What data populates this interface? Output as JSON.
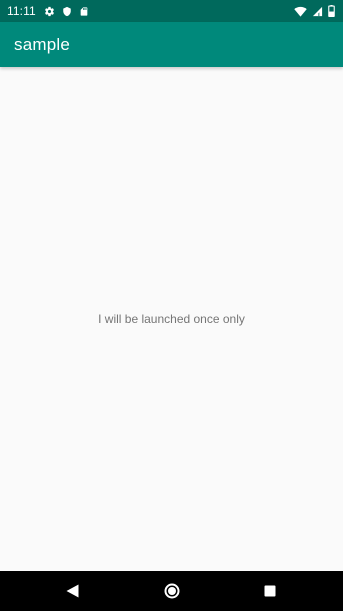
{
  "status_bar": {
    "time": "11:11",
    "icons": [
      "gear-icon",
      "shield-icon",
      "sd-card-icon",
      "wifi-icon",
      "signal-icon",
      "battery-icon"
    ]
  },
  "app_bar": {
    "title": "sample",
    "color": "#00897b"
  },
  "content": {
    "message": "I will be launched once only"
  },
  "nav_bar": {
    "buttons": [
      "back",
      "home",
      "recents"
    ]
  },
  "colors": {
    "status_bar": "#00695c",
    "app_bar": "#00897b",
    "background": "#fafafa",
    "message_text": "#757575"
  }
}
